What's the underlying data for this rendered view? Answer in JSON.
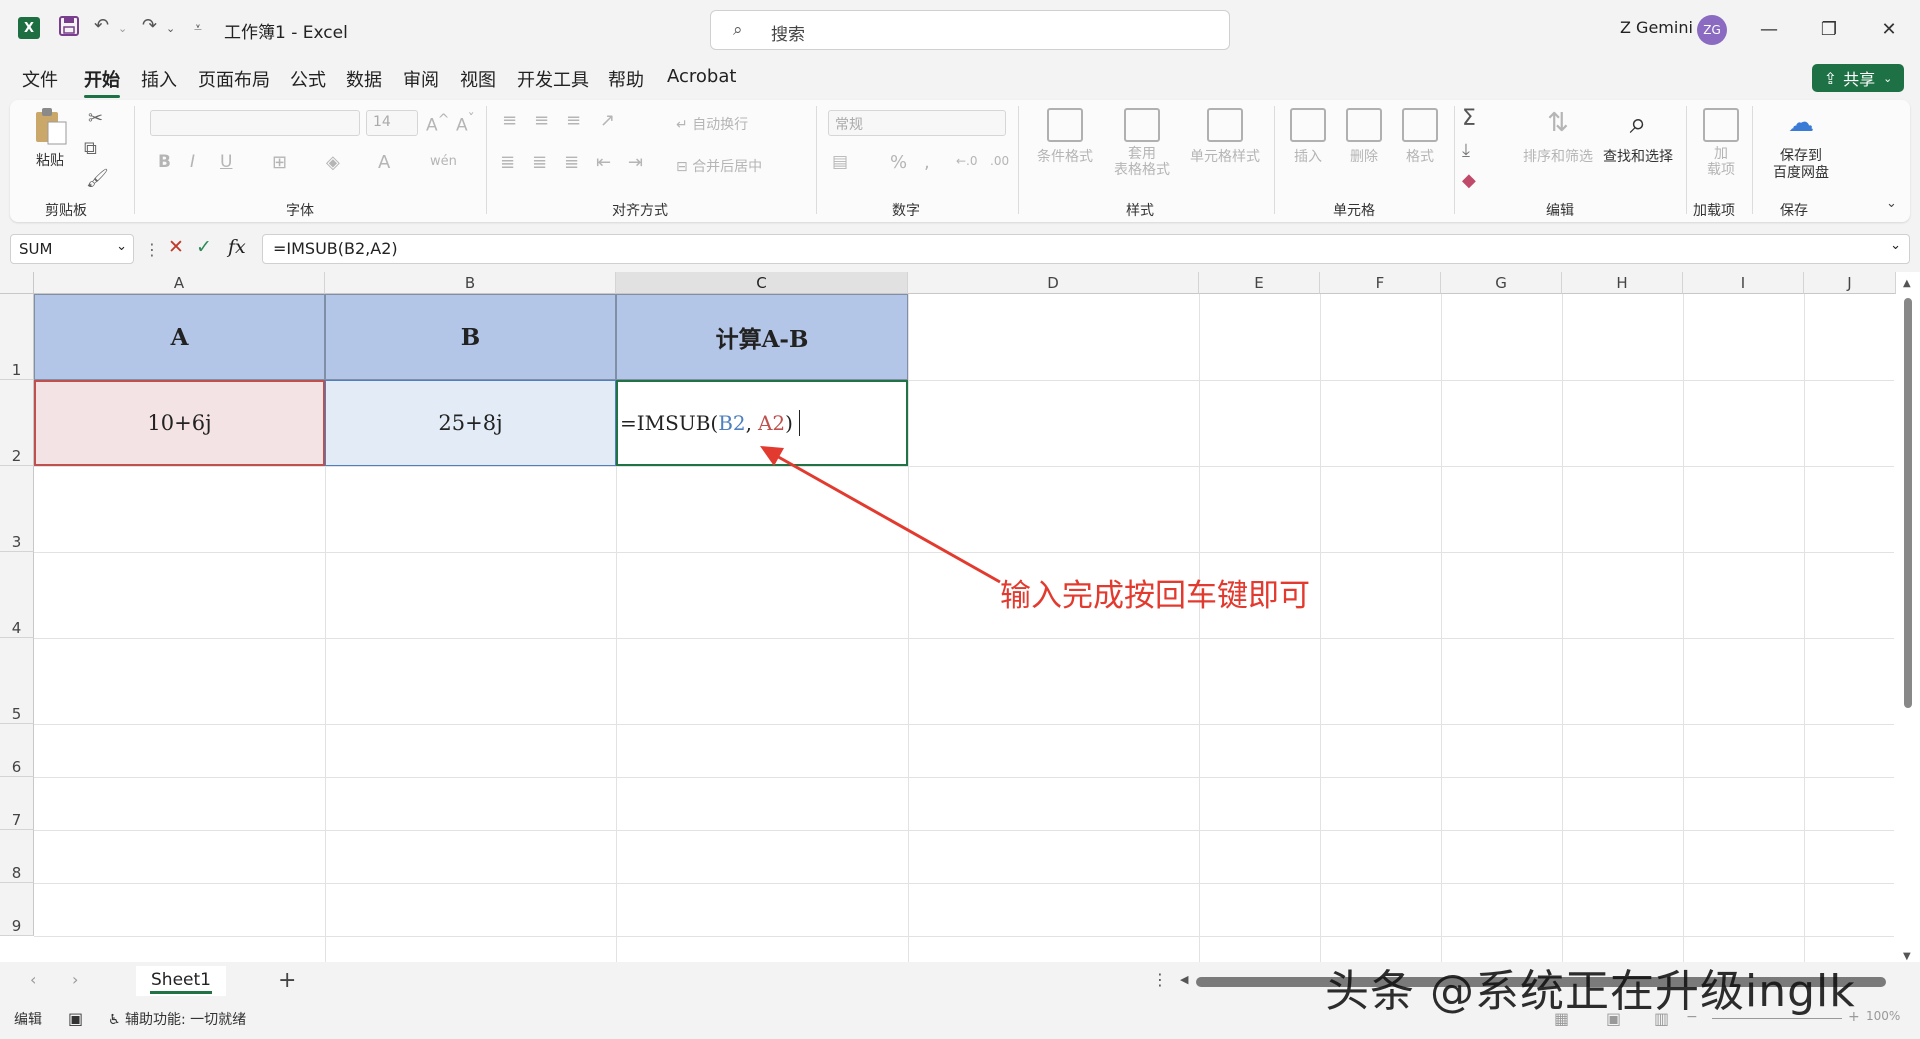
{
  "window": {
    "title": "工作簿1 - Excel",
    "search_placeholder": "搜索",
    "user_name": "Z Gemini",
    "user_initials": "ZG",
    "accent_color": "#1e7145"
  },
  "menu": {
    "items": [
      "文件",
      "开始",
      "插入",
      "页面布局",
      "公式",
      "数据",
      "审阅",
      "视图",
      "开发工具",
      "帮助",
      "Acrobat"
    ],
    "active": "开始",
    "share_label": "共享"
  },
  "ribbon": {
    "paste_label": "粘贴",
    "font_size": "14",
    "wrap_text_label": "自动换行",
    "merge_center_label": "合并后居中",
    "number_format": "常规",
    "conditional_format_label": "条件格式",
    "table_format_label_1": "套用",
    "table_format_label_2": "表格格式",
    "cell_style_label": "单元格样式",
    "insert_label": "插入",
    "delete_label": "删除",
    "format_label": "格式",
    "sort_filter_label": "排序和筛选",
    "find_select_label": "查找和选择",
    "addin_label_1": "加",
    "addin_label_2": "载项",
    "save_baidu_label_1": "保存到",
    "save_baidu_label_2": "百度网盘",
    "groups": [
      "剪贴板",
      "字体",
      "对齐方式",
      "数字",
      "样式",
      "单元格",
      "编辑",
      "加载项",
      "保存"
    ]
  },
  "formula_bar": {
    "name_box": "SUM",
    "formula": "=IMSUB(B2,A2)"
  },
  "grid": {
    "columns": [
      "A",
      "B",
      "C",
      "D",
      "E",
      "F",
      "G",
      "H",
      "I",
      "J"
    ],
    "rows": [
      "1",
      "2",
      "3",
      "4",
      "5",
      "6",
      "7",
      "8",
      "9"
    ],
    "selected_column": "C",
    "cells": {
      "A1": "A",
      "B1": "B",
      "C1": "计算A-B",
      "A2": "10+6j",
      "B2": "25+8j",
      "C2_prefix": "=IMSUB(",
      "C2_ref1": "B2",
      "C2_sep": ",",
      "C2_ref2": "A2",
      "C2_suffix": ")"
    },
    "header_fill": "#b4c6e7"
  },
  "annotation": {
    "text": "输入完成按回车键即可",
    "color": "#e33a2f"
  },
  "sheets": {
    "tabs": [
      "Sheet1"
    ],
    "add_label": "+"
  },
  "status": {
    "mode": "编辑",
    "accessibility": "辅助功能: 一切就绪",
    "zoom": "100%"
  },
  "watermark": "头条 @系统正在升级inglk"
}
